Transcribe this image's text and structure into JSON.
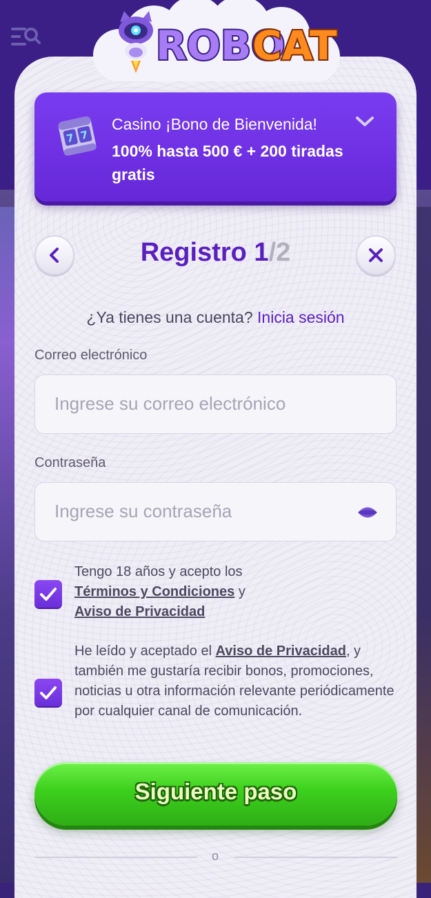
{
  "brand": {
    "logo_text": "ROBOCAT",
    "colors": {
      "primary": "#5a1fbf",
      "bonus_bg": "#6a2fe0",
      "cta_green": "#3ccf1c"
    }
  },
  "header": {
    "menu_icon": "menu-search-icon"
  },
  "bonus": {
    "title": "Casino ¡Bono de Bienvenida!",
    "text": "100% hasta 500 € + 200 tiradas gratis",
    "icon": "slot-machine-icon",
    "expand_icon": "chevron-down-icon"
  },
  "registration": {
    "title": "Registro",
    "step_current": "1",
    "step_total": "/2",
    "back_icon": "chevron-left-icon",
    "close_icon": "close-icon",
    "has_account_text": "¿Ya tienes una cuenta?",
    "login_link": "Inicia sesión",
    "email": {
      "label": "Correo electrónico",
      "placeholder": "Ingrese su correo electrónico"
    },
    "password": {
      "label": "Contraseña",
      "placeholder": "Ingrese su contraseña",
      "toggle_icon": "eye-icon"
    },
    "terms": {
      "checked": true,
      "text_before": "Tengo 18 años y acepto los",
      "terms_link": "Términos y Condiciones",
      "and": " y",
      "privacy_link": "Aviso de Privacidad"
    },
    "marketing": {
      "checked": true,
      "text_before": "He leído y aceptado el ",
      "privacy_link": "Aviso de Privacidad",
      "text_after": ", y también me gustaría recibir bonos, promociones, noticias u otra información relevante periódicamente por cualquier canal de comunicación."
    },
    "next_button": "Siguiente paso",
    "divider_text": "o"
  }
}
